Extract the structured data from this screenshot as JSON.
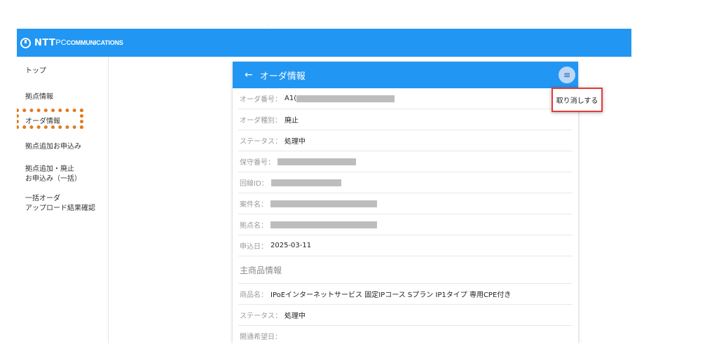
{
  "brand": {
    "logo_main": "NTT",
    "logo_pc": "PC",
    "logo_sub": "COMMUNICATIONS"
  },
  "sidebar": {
    "items": [
      {
        "label": "トップ"
      },
      {
        "label": "拠点情報"
      },
      {
        "label": "オーダ情報",
        "highlighted": true
      },
      {
        "label": "拠点追加お申込み"
      },
      {
        "label": "拠点追加・廃止\nお申込み（一括）"
      },
      {
        "label": "一括オーダ\nアップロード結果確認"
      }
    ]
  },
  "panel": {
    "title": "オーダ情報",
    "back_icon": "arrow-left-icon",
    "menu_icon": "hamburger-icon",
    "rows": [
      {
        "label": "オーダ番号",
        "value": "A1(",
        "masked": true
      },
      {
        "label": "オーダ種別",
        "value": "廃止"
      },
      {
        "label": "ステータス",
        "value": "処理中"
      },
      {
        "label": "保守番号",
        "value": "",
        "masked": true
      },
      {
        "label": "回線ID",
        "value": "",
        "masked": true
      },
      {
        "label": "案件名",
        "value": "",
        "masked": true
      },
      {
        "label": "拠点名",
        "value": "",
        "masked": true
      },
      {
        "label": "申込日",
        "value": "2025-03-11"
      }
    ],
    "section_title": "主商品情報",
    "product_rows": [
      {
        "label": "商品名",
        "value": "IPoEインターネットサービス 固定IPコース Sプラン IP1タイプ 専用CPE付き"
      },
      {
        "label": "ステータス",
        "value": "処理中"
      },
      {
        "label": "開通希望日",
        "value": ""
      }
    ]
  },
  "dropdown": {
    "cancel_label": "取り消しする"
  },
  "colors": {
    "primary": "#2196f3",
    "highlight_dotted": "#e07c1f",
    "highlight_box": "#e53935"
  }
}
